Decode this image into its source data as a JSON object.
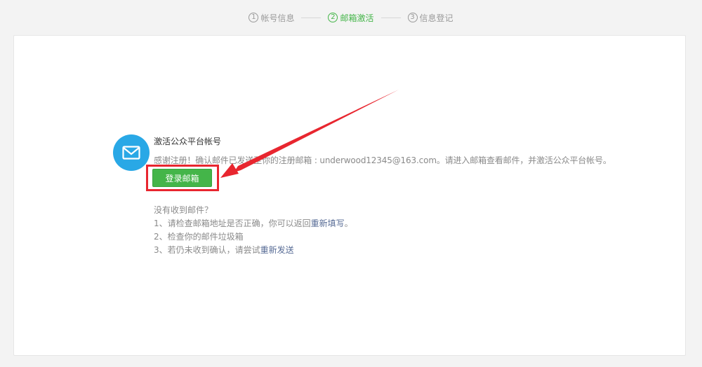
{
  "steps": [
    {
      "num": "1",
      "label": "帐号信息",
      "active": false
    },
    {
      "num": "2",
      "label": "邮箱激活",
      "active": true
    },
    {
      "num": "3",
      "label": "信息登记",
      "active": false
    }
  ],
  "activation": {
    "title": "激活公众平台帐号",
    "description": "感谢注册！确认邮件已发送至你的注册邮箱 : underwood12345@163.com。请进入邮箱查看邮件，并激活公众平台帐号。",
    "login_button": "登录邮箱"
  },
  "help": {
    "heading": "没有收到邮件？",
    "line1_prefix": "1、请检查邮箱地址是否正确，你可以返回",
    "line1_link": "重新填写",
    "line1_suffix": "。",
    "line2": "2、检查你的邮件垃圾箱",
    "line3_prefix": "3、若仍未收到确认，请尝试",
    "line3_link": "重新发送"
  },
  "colors": {
    "accent_green": "#44b549",
    "mail_blue": "#29a8e6",
    "annotation_red": "#e8262f",
    "link_blue": "#576b95"
  }
}
